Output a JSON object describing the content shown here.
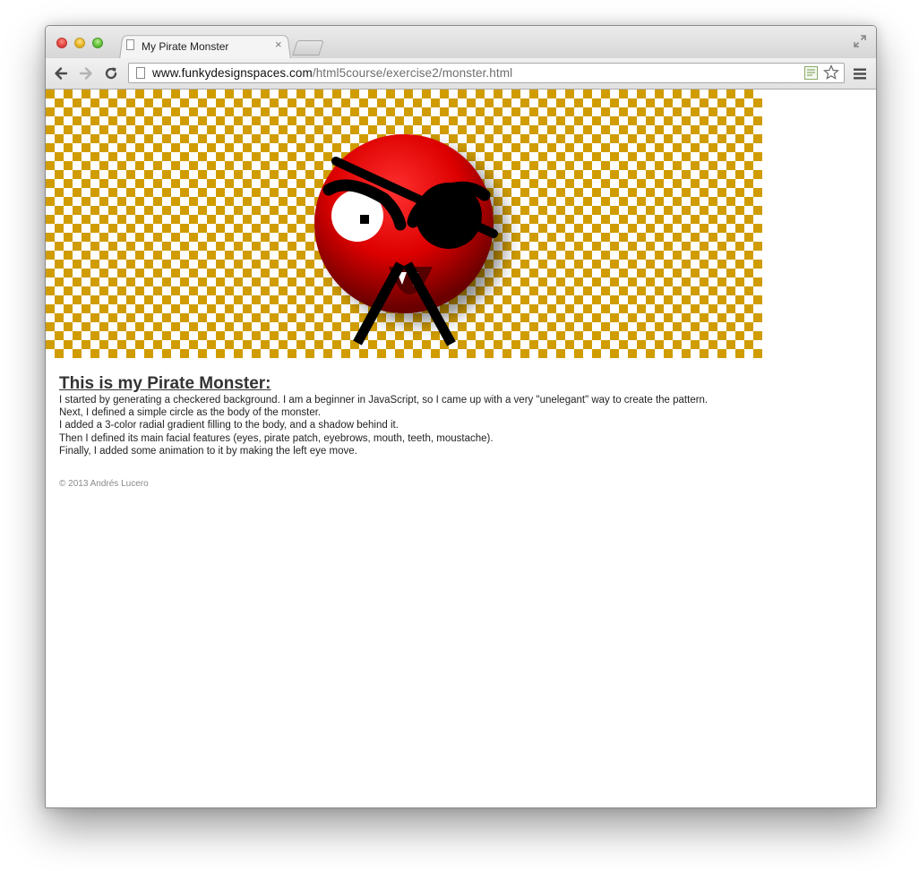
{
  "browser": {
    "tab_title": "My Pirate Monster",
    "tab_close": "×",
    "url_host": "www.funkydesignspaces.com",
    "url_path": "/html5course/exercise2/monster.html",
    "icons": [
      "back-arrow-icon",
      "forward-arrow-icon",
      "reload-icon",
      "page-icon",
      "html5-extension-icon",
      "star-icon",
      "menu-icon",
      "fullscreen-icon"
    ]
  },
  "page": {
    "canvas": {
      "checker_colors": [
        "#d09c00",
        "#ffffff"
      ],
      "monster_colors": [
        "#ff3030",
        "#dd0000",
        "#6a0000"
      ]
    },
    "heading": "This is my Pirate Monster:",
    "paragraphs": [
      "I started by generating a checkered background. I am a beginner in JavaScript, so I came up with a very \"unelegant\" way to create the pattern.",
      "Next, I defined a simple circle as the body of the monster.",
      "I added a 3-color radial gradient filling to the body, and a shadow behind it.",
      "Then I defined its main facial features (eyes, pirate patch, eyebrows, mouth, teeth, moustache).",
      "Finally, I added some animation to it by making the left eye move."
    ],
    "footer": "© 2013 Andrés Lucero"
  }
}
